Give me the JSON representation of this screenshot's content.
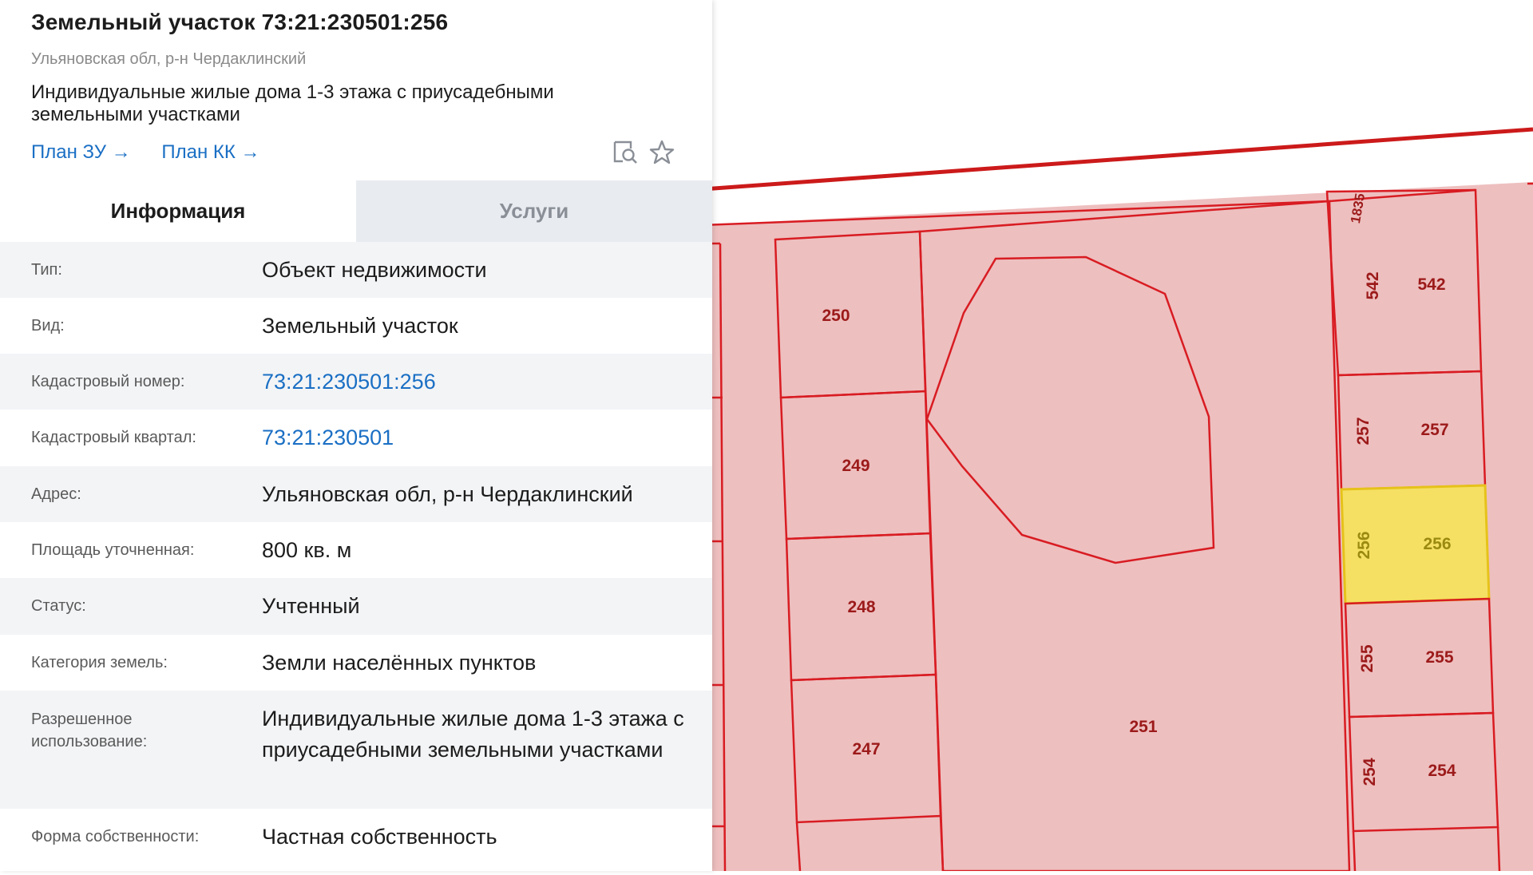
{
  "header": {
    "title": "Земельный участок 73:21:230501:256",
    "subtitle": "Ульяновская обл, р-н Чердаклинский",
    "usage": "Индивидуальные жилые дома 1-3 этажа с приусадебными земельными участками",
    "link_plan_zu": "План ЗУ",
    "link_plan_kk": "План КК",
    "arrow": "→",
    "icons": [
      "search-document-icon",
      "star-icon"
    ]
  },
  "tabs": {
    "info": "Информация",
    "services": "Услуги"
  },
  "info": {
    "type_label": "Тип:",
    "type_value": "Объект недвижимости",
    "kind_label": "Вид:",
    "kind_value": "Земельный участок",
    "cad_num_label": "Кадастровый номер:",
    "cad_num_value": "73:21:230501:256",
    "cad_block_label": "Кадастровый квартал:",
    "cad_block_value": "73:21:230501",
    "address_label": "Адрес:",
    "address_value": "Ульяновская обл, р-н Чердаклинский",
    "area_label": "Площадь уточненная:",
    "area_value": "800 кв. м",
    "status_label": "Статус:",
    "status_value": "Учтенный",
    "category_label": "Категория земель:",
    "category_value": "Земли населённых пунктов",
    "use_label": "Разрешенное использование:",
    "use_value": "Индивидуальные жилые дома 1-3 этажа с приусадебными земельными участками",
    "ownership_label": "Форма собственности:",
    "ownership_value": "Частная собственность"
  },
  "map": {
    "parcel_labels": {
      "p250": "250",
      "p249": "249",
      "p248": "248",
      "p247": "247",
      "p251": "251",
      "p542": "542",
      "p257": "257",
      "p256": "256",
      "p255": "255",
      "p254": "254",
      "p1835": "1835"
    },
    "colors": {
      "parcel_fill": "#eebfbf",
      "parcel_line": "#d81c22",
      "selected_fill": "#f5e063",
      "boundary": "#cc1a1a"
    }
  }
}
